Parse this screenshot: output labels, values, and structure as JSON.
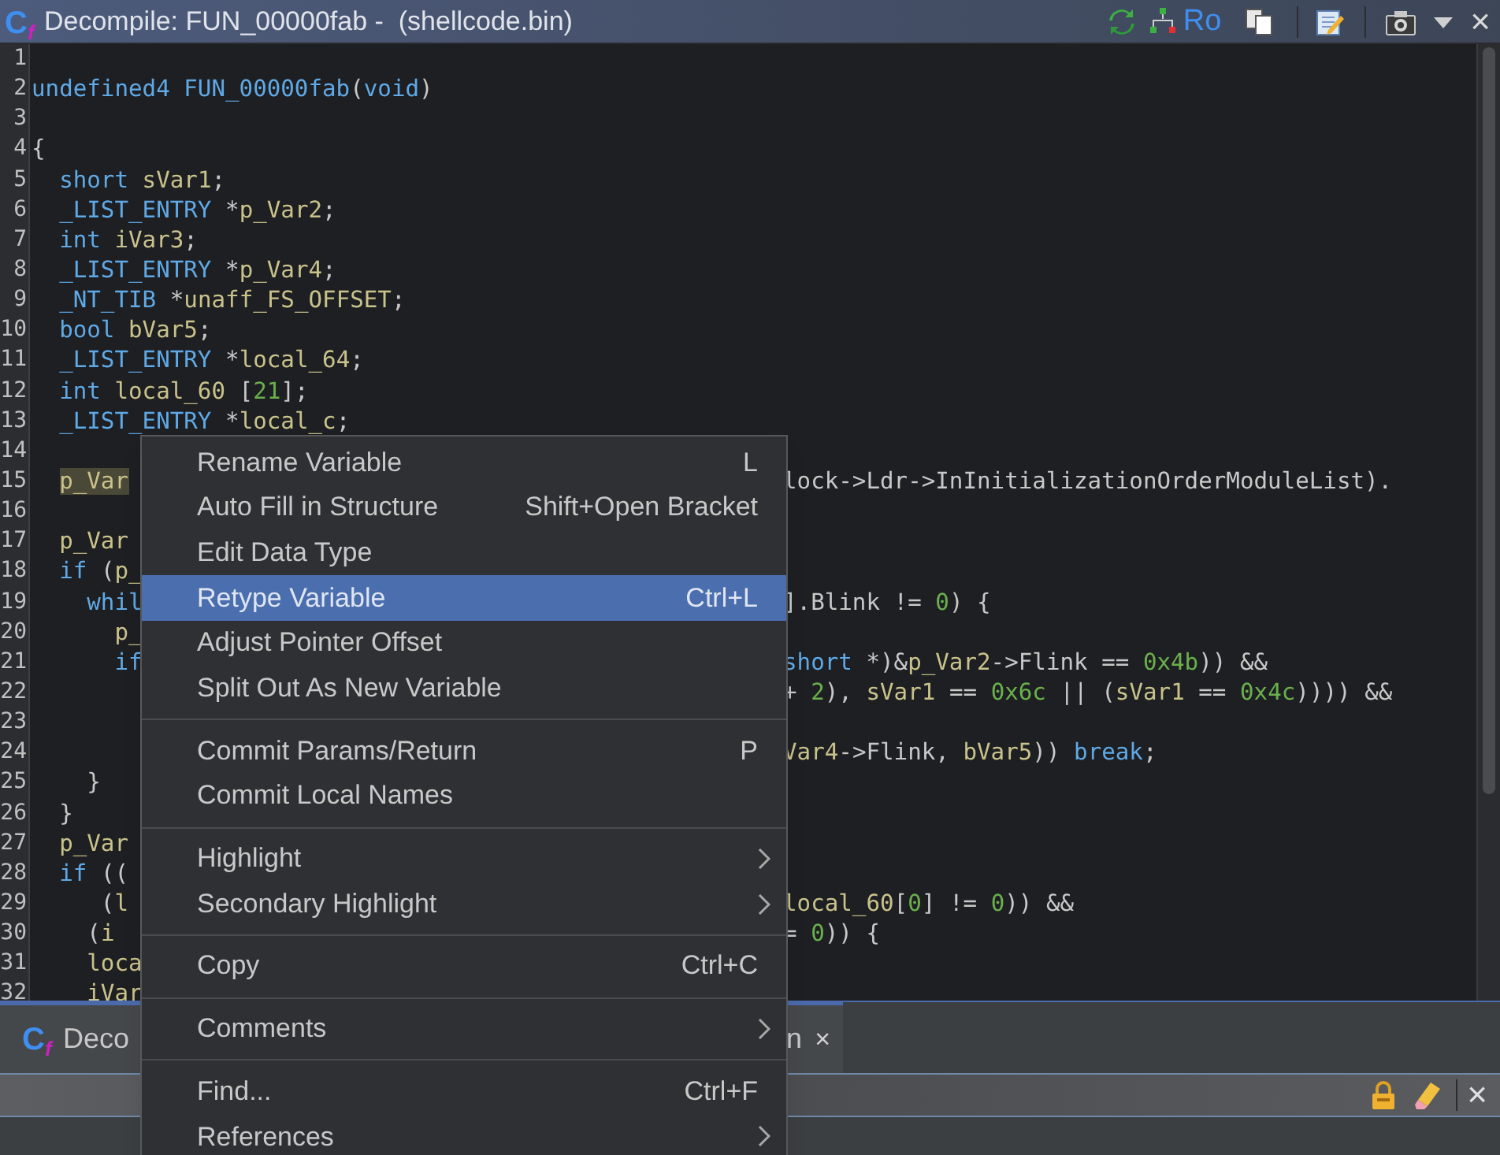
{
  "window": {
    "title": "Decompile: FUN_00000fab -  (shellcode.bin)",
    "icon": {
      "main": "C",
      "sub": "f"
    },
    "toolbar_text": "Ro",
    "close": "×"
  },
  "code": {
    "lines": [
      {
        "num": "1"
      },
      {
        "num": "2",
        "left": [
          {
            "text": "undefined4 FUN_00000fab",
            "kind": "type"
          },
          {
            "text": "(",
            "kind": "plain"
          },
          {
            "text": "void",
            "kind": "type"
          },
          {
            "text": ")",
            "kind": "plain"
          }
        ]
      },
      {
        "num": "3"
      },
      {
        "num": "4",
        "left": [
          {
            "text": "{",
            "kind": "plain"
          }
        ]
      },
      {
        "num": "5",
        "left": [
          {
            "text": "  short ",
            "kind": "type"
          },
          {
            "text": "sVar1",
            "kind": "var"
          },
          {
            "text": ";",
            "kind": "plain"
          }
        ]
      },
      {
        "num": "6",
        "left": [
          {
            "text": "  _LIST_ENTRY ",
            "kind": "type"
          },
          {
            "text": "*",
            "kind": "plain"
          },
          {
            "text": "p_Var2",
            "kind": "var"
          },
          {
            "text": ";",
            "kind": "plain"
          }
        ]
      },
      {
        "num": "7",
        "left": [
          {
            "text": "  int ",
            "kind": "type"
          },
          {
            "text": "iVar3",
            "kind": "var"
          },
          {
            "text": ";",
            "kind": "plain"
          }
        ]
      },
      {
        "num": "8",
        "left": [
          {
            "text": "  _LIST_ENTRY ",
            "kind": "type"
          },
          {
            "text": "*",
            "kind": "plain"
          },
          {
            "text": "p_Var4",
            "kind": "var"
          },
          {
            "text": ";",
            "kind": "plain"
          }
        ]
      },
      {
        "num": "9",
        "left": [
          {
            "text": "  _NT_TIB ",
            "kind": "type"
          },
          {
            "text": "*",
            "kind": "plain"
          },
          {
            "text": "unaff_FS_OFFSET",
            "kind": "var"
          },
          {
            "text": ";",
            "kind": "plain"
          }
        ]
      },
      {
        "num": "10",
        "left": [
          {
            "text": "  bool ",
            "kind": "type"
          },
          {
            "text": "bVar5",
            "kind": "var"
          },
          {
            "text": ";",
            "kind": "plain"
          }
        ]
      },
      {
        "num": "11",
        "left": [
          {
            "text": "  _LIST_ENTRY ",
            "kind": "type"
          },
          {
            "text": "*",
            "kind": "plain"
          },
          {
            "text": "local_64",
            "kind": "var"
          },
          {
            "text": ";",
            "kind": "plain"
          }
        ]
      },
      {
        "num": "12",
        "left": [
          {
            "text": "  int ",
            "kind": "type"
          },
          {
            "text": "local_60 ",
            "kind": "var"
          },
          {
            "text": "[",
            "kind": "plain"
          },
          {
            "text": "21",
            "kind": "num"
          },
          {
            "text": "];",
            "kind": "plain"
          }
        ]
      },
      {
        "num": "13",
        "left": [
          {
            "text": "  _LIST_ENTRY ",
            "kind": "type"
          },
          {
            "text": "*",
            "kind": "plain"
          },
          {
            "text": "local_c",
            "kind": "var"
          },
          {
            "text": ";",
            "kind": "plain"
          }
        ]
      },
      {
        "num": "14"
      },
      {
        "num": "15",
        "left": [
          {
            "text": "  p_Var",
            "kind": "highlight"
          }
        ],
        "right": [
          {
            "text": "lock->Ldr->InInitializationOrderModuleList).",
            "kind": "plain"
          }
        ]
      },
      {
        "num": "16"
      },
      {
        "num": "17",
        "left": [
          {
            "text": "  p_Var",
            "kind": "var"
          }
        ]
      },
      {
        "num": "18",
        "left": [
          {
            "text": "  if ",
            "kind": "type"
          },
          {
            "text": "(",
            "kind": "plain"
          },
          {
            "text": "p_",
            "kind": "var"
          }
        ]
      },
      {
        "num": "19",
        "left": [
          {
            "text": "    whil",
            "kind": "type"
          }
        ],
        "right": [
          {
            "text": "].Blink != ",
            "kind": "plain"
          },
          {
            "text": "0",
            "kind": "num"
          },
          {
            "text": ") {",
            "kind": "plain"
          }
        ]
      },
      {
        "num": "20",
        "left": [
          {
            "text": "      p_",
            "kind": "var"
          }
        ]
      },
      {
        "num": "21",
        "left": [
          {
            "text": "      if",
            "kind": "type"
          }
        ],
        "right": [
          {
            "text": "short ",
            "kind": "type"
          },
          {
            "text": "*)&",
            "kind": "plain"
          },
          {
            "text": "p_Var2",
            "kind": "var"
          },
          {
            "text": "->Flink == ",
            "kind": "plain"
          },
          {
            "text": "0x4b",
            "kind": "num"
          },
          {
            "text": ")) &&",
            "kind": "plain"
          }
        ]
      },
      {
        "num": "22",
        "right": [
          {
            "text": "+ ",
            "kind": "plain"
          },
          {
            "text": "2",
            "kind": "num"
          },
          {
            "text": "), ",
            "kind": "plain"
          },
          {
            "text": "sVar1",
            "kind": "var"
          },
          {
            "text": " == ",
            "kind": "plain"
          },
          {
            "text": "0x6c",
            "kind": "num"
          },
          {
            "text": " || (",
            "kind": "plain"
          },
          {
            "text": "sVar1",
            "kind": "var"
          },
          {
            "text": " == ",
            "kind": "plain"
          },
          {
            "text": "0x4c",
            "kind": "num"
          },
          {
            "text": ")))) &&",
            "kind": "plain"
          }
        ]
      },
      {
        "num": "23"
      },
      {
        "num": "24",
        "right": [
          {
            "text": "Var4",
            "kind": "var"
          },
          {
            "text": "->Flink, ",
            "kind": "plain"
          },
          {
            "text": "bVar5",
            "kind": "var"
          },
          {
            "text": ")) ",
            "kind": "plain"
          },
          {
            "text": "break",
            "kind": "type"
          },
          {
            "text": ";",
            "kind": "plain"
          }
        ]
      },
      {
        "num": "25",
        "left": [
          {
            "text": "    }",
            "kind": "plain"
          }
        ]
      },
      {
        "num": "26",
        "left": [
          {
            "text": "  }",
            "kind": "plain"
          }
        ]
      },
      {
        "num": "27",
        "left": [
          {
            "text": "  p_Var",
            "kind": "var"
          }
        ]
      },
      {
        "num": "28",
        "left": [
          {
            "text": "  if ",
            "kind": "type"
          },
          {
            "text": "((",
            "kind": "plain"
          }
        ]
      },
      {
        "num": "29",
        "left": [
          {
            "text": "     (",
            "kind": "plain"
          },
          {
            "text": "l",
            "kind": "var"
          }
        ],
        "right": [
          {
            "text": "local_60",
            "kind": "var"
          },
          {
            "text": "[",
            "kind": "plain"
          },
          {
            "text": "0",
            "kind": "num"
          },
          {
            "text": "] != ",
            "kind": "plain"
          },
          {
            "text": "0",
            "kind": "num"
          },
          {
            "text": ")) &&",
            "kind": "plain"
          }
        ]
      },
      {
        "num": "30",
        "left": [
          {
            "text": "    (",
            "kind": "plain"
          },
          {
            "text": "i",
            "kind": "var"
          }
        ],
        "right": [
          {
            "text": "= ",
            "kind": "plain"
          },
          {
            "text": "0",
            "kind": "num"
          },
          {
            "text": ")) {",
            "kind": "plain"
          }
        ]
      },
      {
        "num": "31",
        "left": [
          {
            "text": "    loca",
            "kind": "var"
          }
        ]
      },
      {
        "num": "32",
        "left": [
          {
            "text": "    iVar",
            "kind": "var"
          }
        ]
      }
    ]
  },
  "context_menu": {
    "sections": [
      [
        {
          "label": "Rename Variable",
          "shortcut": "L",
          "submenu": false,
          "selected": false
        },
        {
          "label": "Auto Fill in Structure",
          "shortcut": "Shift+Open Bracket",
          "submenu": false,
          "selected": false
        },
        {
          "label": "Edit Data Type",
          "submenu": false,
          "selected": false
        },
        {
          "label": "Retype Variable",
          "shortcut": "Ctrl+L",
          "submenu": false,
          "selected": true
        },
        {
          "label": "Adjust Pointer Offset",
          "submenu": false,
          "selected": false
        },
        {
          "label": "Split Out As New Variable",
          "submenu": false,
          "selected": false
        }
      ],
      [
        {
          "label": "Commit Params/Return",
          "shortcut": "P",
          "submenu": false,
          "selected": false
        },
        {
          "label": "Commit Local Names",
          "submenu": false,
          "selected": false
        }
      ],
      [
        {
          "label": "Highlight",
          "submenu": true,
          "selected": false
        },
        {
          "label": "Secondary Highlight",
          "submenu": true,
          "selected": false
        }
      ],
      [
        {
          "label": "Copy",
          "shortcut": "Ctrl+C",
          "submenu": false,
          "selected": false
        }
      ],
      [
        {
          "label": "Comments",
          "submenu": true,
          "selected": false
        }
      ],
      [
        {
          "label": "Find...",
          "shortcut": "Ctrl+F",
          "submenu": false,
          "selected": false
        },
        {
          "label": "References",
          "submenu": true,
          "selected": false
        }
      ]
    ]
  },
  "bottom_tab": {
    "icon": {
      "main": "C",
      "sub": "f"
    },
    "label_start": "Deco",
    "label_end": "n",
    "close": "×",
    "selected": true
  },
  "panel_bar": {
    "close": "×"
  }
}
